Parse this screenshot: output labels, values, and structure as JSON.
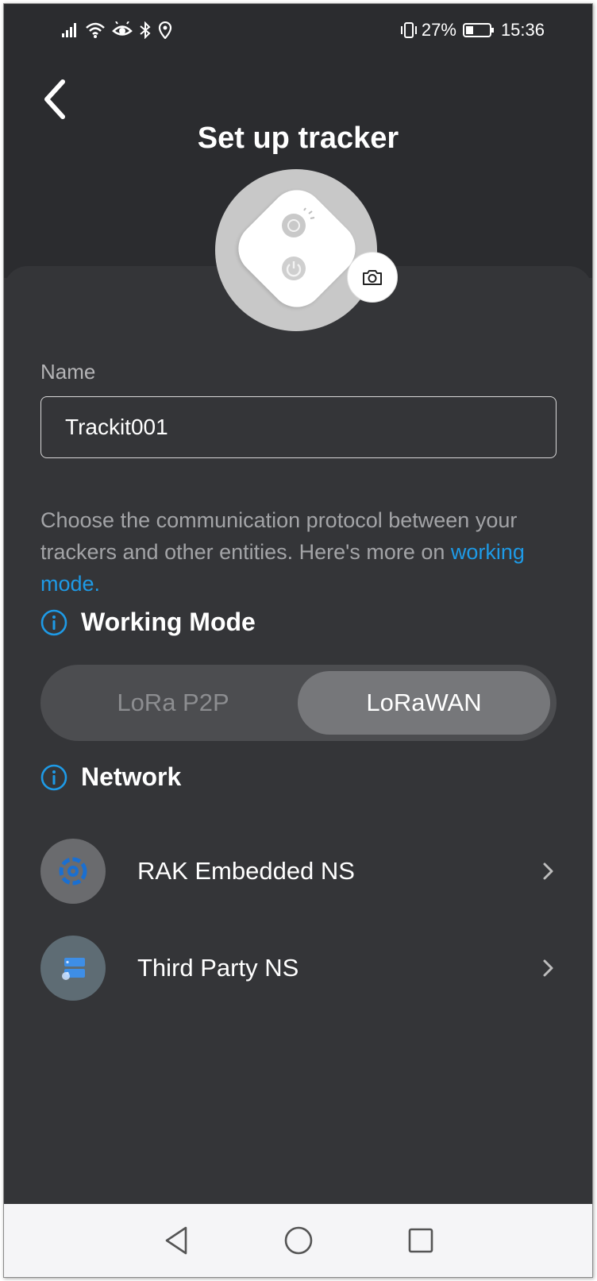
{
  "status_bar": {
    "battery_percent": "27%",
    "time": "15:36",
    "left_icons": [
      "signal-icon",
      "wifi-icon",
      "eye-icon",
      "bluetooth-icon",
      "location-icon"
    ],
    "right_icons": [
      "vibrate-icon",
      "battery-icon"
    ]
  },
  "header": {
    "title": "Set up tracker",
    "back_icon": "chevron-left-icon"
  },
  "avatar": {
    "camera_icon": "camera-icon"
  },
  "form": {
    "name_label": "Name",
    "name_value": "Trackit001"
  },
  "description": {
    "text": "Choose the communication protocol between your trackers and other entities. Here's more on",
    "link": "working mode."
  },
  "working_mode": {
    "heading": "Working Mode",
    "options": [
      "LoRa P2P",
      "LoRaWAN"
    ],
    "selected": "LoRaWAN"
  },
  "network": {
    "heading": "Network",
    "items": [
      {
        "label": "RAK Embedded NS",
        "icon": "rak-logo-icon"
      },
      {
        "label": "Third Party NS",
        "icon": "server-icon"
      }
    ]
  },
  "nav_bar": [
    "back-triangle-icon",
    "home-circle-icon",
    "recents-square-icon"
  ],
  "colors": {
    "background": "#343538",
    "accent": "#1e9ae6",
    "text": "#ffffff",
    "muted_text": "#a3a4a7"
  }
}
